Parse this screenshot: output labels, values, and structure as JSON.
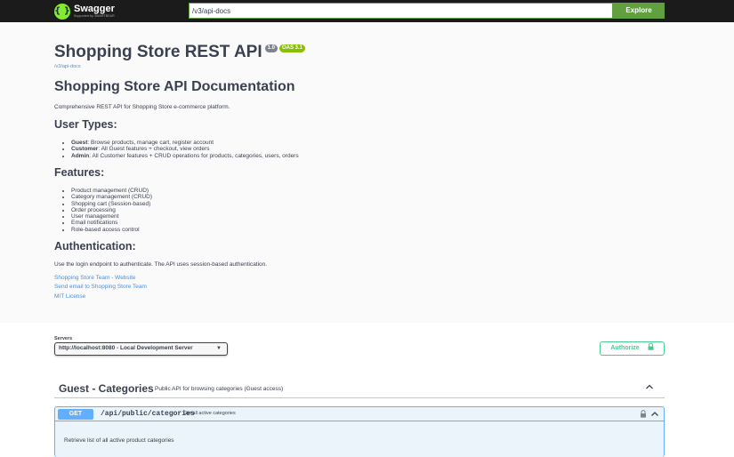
{
  "topbar": {
    "logo_title": "Swagger",
    "logo_subtitle": "Supported by SMARTBEAR",
    "url_value": "/v3/api-docs",
    "explore_label": "Explore"
  },
  "info": {
    "title": "Shopping Store REST API",
    "version": "1.0",
    "oas": "OAS 3.1",
    "spec_link": "/v3/api-docs",
    "heading": "Shopping Store API Documentation",
    "description": "Comprehensive REST API for Shopping Store e-commerce platform.",
    "user_types_heading": "User Types:",
    "user_types": [
      {
        "name": "Guest",
        "text": ": Browse products, manage cart, register account"
      },
      {
        "name": "Customer",
        "text": ": All Guest features + checkout, view orders"
      },
      {
        "name": "Admin",
        "text": ": All Customer features + CRUD operations for products, categories, users, orders"
      }
    ],
    "features_heading": "Features:",
    "features": [
      "Product management (CRUD)",
      "Category management (CRUD)",
      "Shopping cart (Session-based)",
      "Order processing",
      "User management",
      "Email notifications",
      "Role-based access control"
    ],
    "auth_heading": "Authentication:",
    "auth_text": "Use the login endpoint to authenticate. The API uses session-based authentication.",
    "links": {
      "website": "Shopping Store Team - Website",
      "email": "Send email to Shopping Store Team",
      "license": "MIT License"
    }
  },
  "servers": {
    "label": "Servers",
    "selected": "http://localhost:8080 - Local Development Server"
  },
  "authorize_label": "Authorize",
  "tag": {
    "name": "Guest - Categories",
    "description": "Public API for browsing categories (Guest access)"
  },
  "operation": {
    "method": "GET",
    "path": "/api/public/categories",
    "summary": "Get all active categories",
    "description": "Retrieve list of all active product categories"
  },
  "colors": {
    "topbar_bg": "#1b1b1b",
    "swagger_green": "#85ea2d",
    "explore_green": "#62a03f",
    "get_blue": "#61affe",
    "authorize_green": "#49cc90",
    "link_blue": "#4990e2"
  }
}
